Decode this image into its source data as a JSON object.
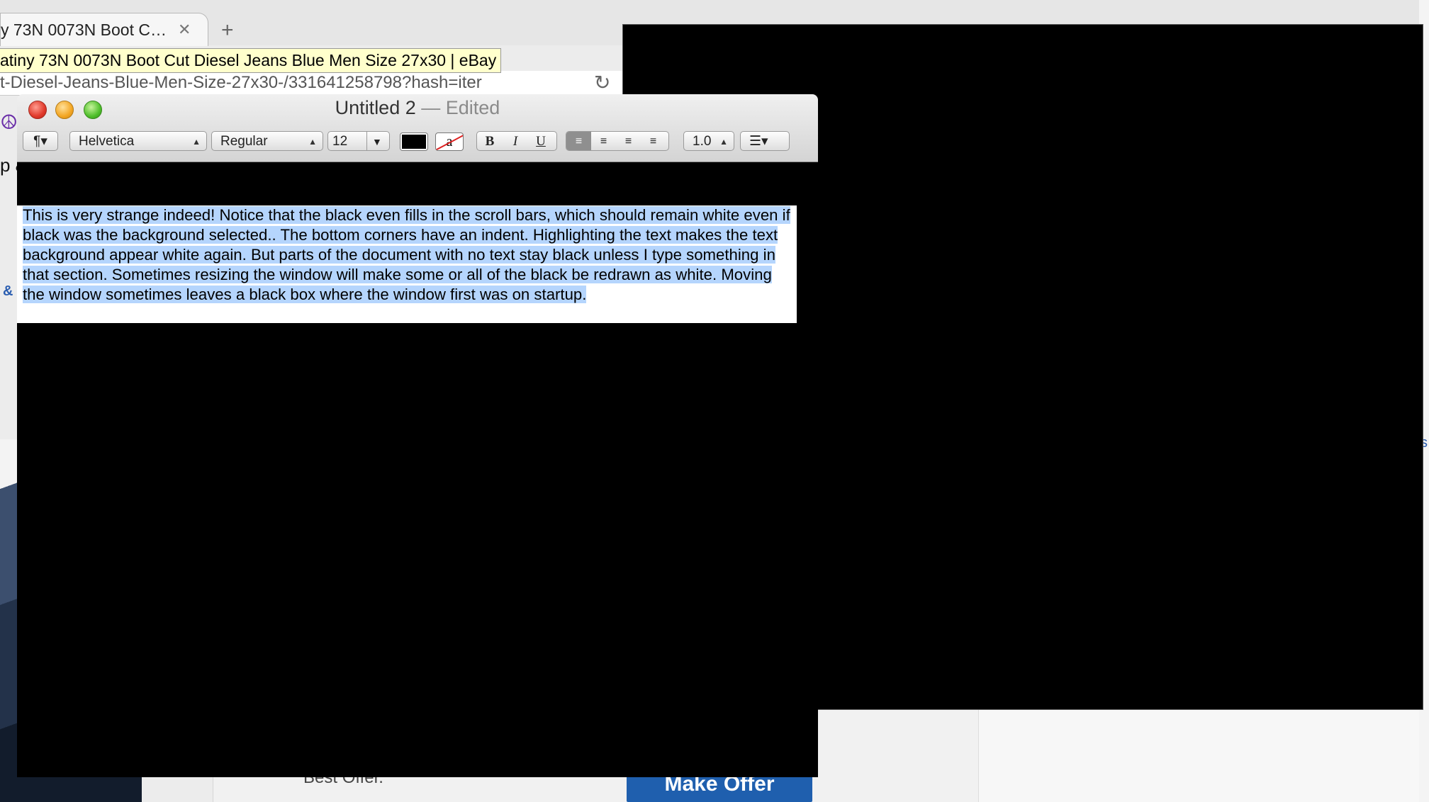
{
  "browser": {
    "tab_title": "y 73N 0073N Boot C…",
    "tab_close": "✕",
    "new_tab": "+",
    "tooltip": "atiny 73N 0073N Boot Cut Diesel Jeans Blue Men Size 27x30 | eBay",
    "url": "t-Diesel-Jeans-Blue-Men-Size-27x30-/331641258798?hash=iter",
    "reload_icon": "↻",
    "left_fragment_1": "p &",
    "left_fragment_2": "&",
    "best_offer": "Best Offer.",
    "make_offer": "Make Offer",
    "right_fragment": "s"
  },
  "textedit": {
    "title": "Untitled 2",
    "edited": "— Edited",
    "toolbar": {
      "paragraph": "¶▾",
      "font": "Helvetica",
      "style": "Regular",
      "size": "12",
      "bold": "B",
      "italic": "I",
      "underline": "U",
      "spacing": "1.0",
      "list": "☰▾",
      "text_color": "#000000",
      "bg_swatch_glyph": "a"
    },
    "body_text": "This is very strange indeed!  Notice that the black even fills in the scroll bars, which should remain white even if black was the background selected..  The bottom corners have an indent.  Highlighting the text makes the text background appear white again.  But parts of the document with no text stay black unless I type something in that section.  Sometimes resizing the window will make some or all of the black be redrawn as white.  Moving the window sometimes leaves a black box where the window first was on startup."
  },
  "colors": {
    "selection": "#b5d5fd",
    "artifact_black": "#000000",
    "ebay_button": "#1f5fae"
  }
}
